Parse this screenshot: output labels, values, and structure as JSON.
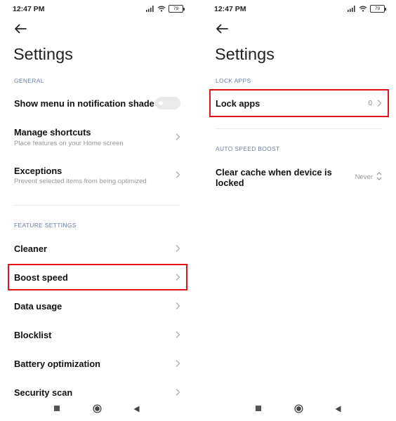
{
  "colors": {
    "accent_highlight": "#e1141a",
    "section_label": "#6d7fa6",
    "subtitle": "#999999",
    "toggle_off": "#eaeaea"
  },
  "left": {
    "status": {
      "time": "12:47 PM",
      "battery": "79"
    },
    "title": "Settings",
    "general_label": "GENERAL",
    "show_menu": {
      "title": "Show menu in notification shade",
      "enabled": false
    },
    "manage_shortcuts": {
      "title": "Manage shortcuts",
      "subtitle": "Place features on your Home screen"
    },
    "exceptions": {
      "title": "Exceptions",
      "subtitle": "Prevent selected items from being optimized"
    },
    "feature_label": "FEATURE SETTINGS",
    "features": [
      "Cleaner",
      "Boost speed",
      "Data usage",
      "Blocklist",
      "Battery optimization",
      "Security scan"
    ],
    "highlighted_item": "Boost speed"
  },
  "right": {
    "status": {
      "time": "12:47 PM",
      "battery": "79"
    },
    "title": "Settings",
    "lock_label": "LOCK APPS",
    "lock_apps": {
      "title": "Lock apps",
      "value": "0"
    },
    "auto_label": "AUTO SPEED BOOST",
    "clear_cache": {
      "title_line1": "Clear cache when device is",
      "title_line2": "locked",
      "value": "Never"
    },
    "highlighted_item": "Lock apps"
  },
  "icons": [
    "back-arrow-icon",
    "chevron-right-icon",
    "signal-icon",
    "wifi-icon",
    "battery-icon",
    "nav-recents-icon",
    "nav-home-icon",
    "nav-back-icon",
    "up-down-chevron-icon"
  ]
}
